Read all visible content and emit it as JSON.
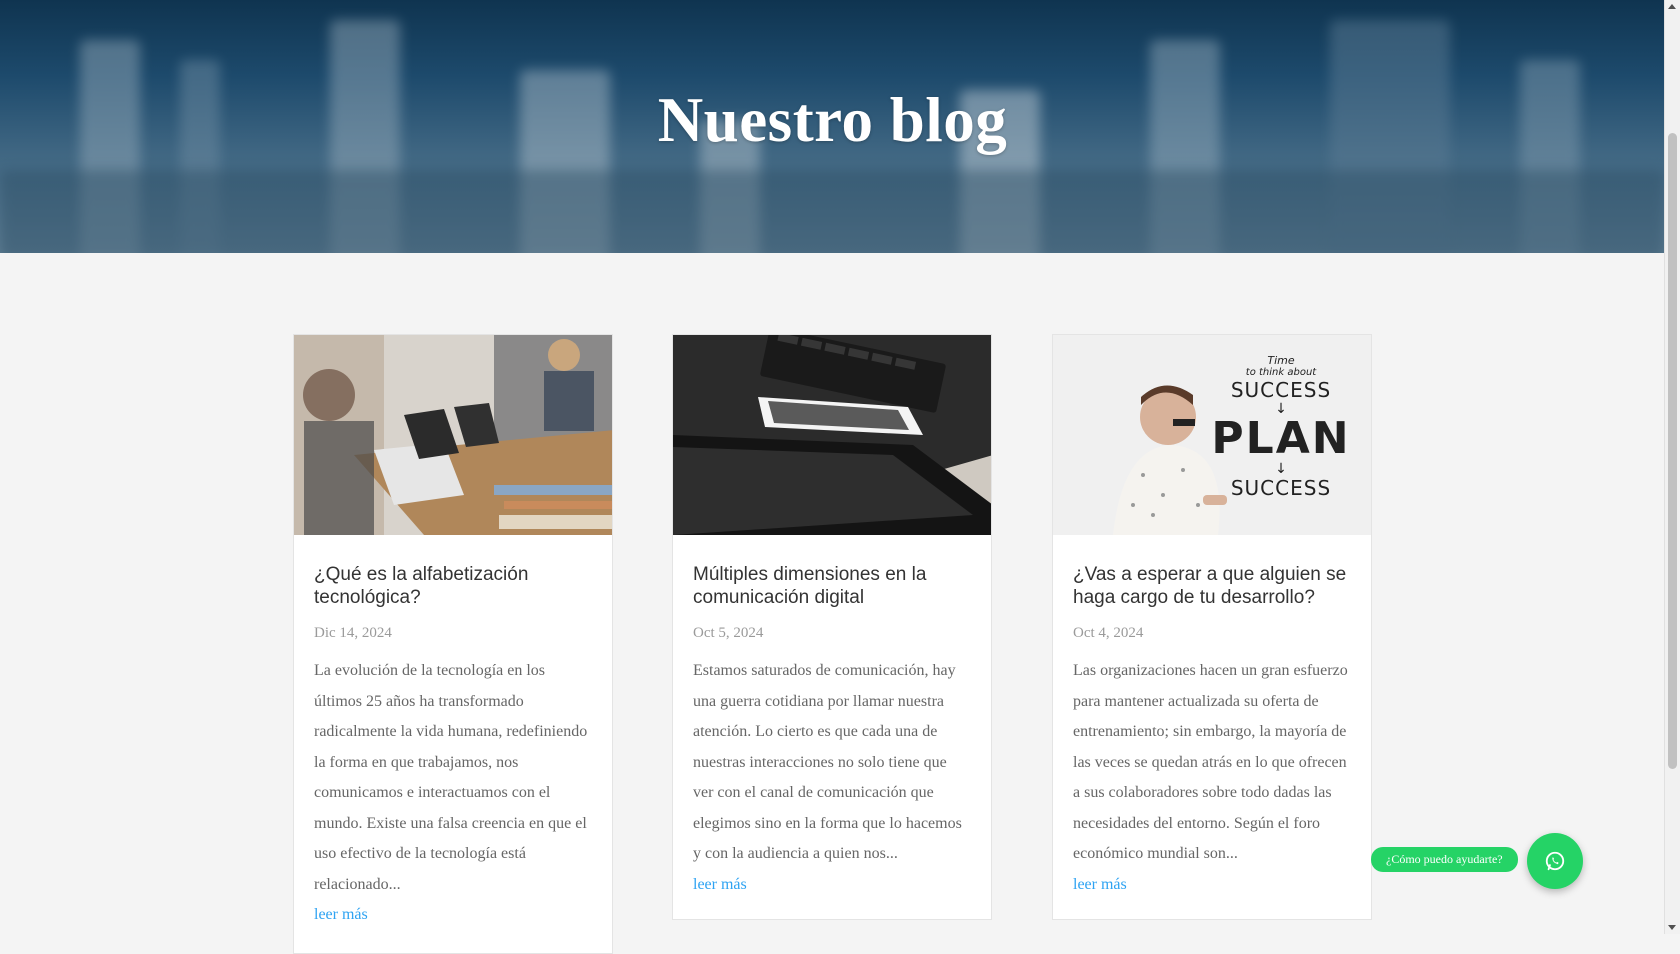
{
  "hero": {
    "title": "Nuestro blog"
  },
  "posts": [
    {
      "title": "¿Qué es la alfabetización tecnológica?",
      "date": "Dic 14, 2024",
      "excerpt": "La evolución de la tecnología en los últimos 25 años ha transformado radicalmente la vida humana, redefiniendo la forma en que trabajamos, nos comunicamos e interactuamos con el mundo. Existe una falsa creencia en que el uso efectivo de la tecnología está relacionado...",
      "link": "leer más"
    },
    {
      "title": "Múltiples dimensiones en la comunicación digital",
      "date": "Oct 5, 2024",
      "excerpt": "Estamos saturados de comunicación, hay una guerra cotidiana por llamar nuestra atención. Lo cierto es que cada una de nuestras interacciones no solo tiene que ver con el canal de comunicación que elegimos sino en la forma que lo hacemos y con la audiencia a quien nos...",
      "link": "leer más"
    },
    {
      "title": "¿Vas a esperar a que alguien se haga cargo de tu desarrollo?",
      "date": "Oct 4, 2024",
      "excerpt": "Las organizaciones hacen un gran esfuerzo para mantener actualizada su oferta de entrenamiento; sin embargo, la mayoría de las veces se quedan atrás en lo que ofrecen a sus colaboradores sobre todo dadas las necesidades del entorno. Según el foro económico mundial son...",
      "link": "leer más"
    }
  ],
  "thumb3_text": {
    "line1": "Time",
    "line2": "to think about",
    "success": "SUCCESS",
    "plan": "PLAN"
  },
  "chat": {
    "bubble": "¿Cómo puedo ayudarte?",
    "icon": "whatsapp-icon"
  },
  "colors": {
    "accent": "#2ea3f2",
    "whatsapp": "#25d366",
    "hero": "#1d4a6c"
  }
}
